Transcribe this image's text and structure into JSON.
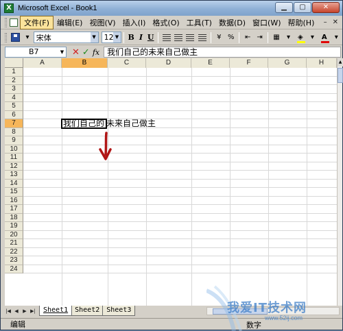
{
  "window": {
    "title": "Microsoft Excel - Book1"
  },
  "menu": {
    "items": [
      "文件(F)",
      "编辑(E)",
      "视图(V)",
      "插入(I)",
      "格式(O)",
      "工具(T)",
      "数据(D)",
      "窗口(W)",
      "帮助(H)"
    ],
    "active_index": 0
  },
  "toolbar": {
    "font_name": "宋体",
    "font_size": "12",
    "bold": "B",
    "italic": "I",
    "underline": "U",
    "percent": "%"
  },
  "formula_bar": {
    "name_box": "B7",
    "cancel": "✕",
    "enter": "✓",
    "fx": "fx",
    "content": "我们自己的未来自己做主"
  },
  "sheet": {
    "columns": [
      "A",
      "B",
      "C",
      "D",
      "E",
      "F",
      "G",
      "H"
    ],
    "rows": [
      "1",
      "2",
      "3",
      "4",
      "5",
      "6",
      "7",
      "8",
      "9",
      "10",
      "11",
      "12",
      "13",
      "14",
      "15",
      "16",
      "17",
      "18",
      "19",
      "20",
      "21",
      "22",
      "23",
      "24"
    ],
    "selected_column": "B",
    "selected_row": "7",
    "cell_B7_text": "我们自己的",
    "overflow_text": "未来自己做主"
  },
  "tabs": [
    "Sheet1",
    "Sheet2",
    "Sheet3"
  ],
  "active_tab": "Sheet1",
  "status": {
    "mode": "编辑",
    "num": "数字"
  },
  "watermark": {
    "title": "我爱IT技术网",
    "url": "www.52ij.com"
  },
  "colors": {
    "selection_header": "#f6b65a",
    "annotation_arrow": "#b01515"
  }
}
